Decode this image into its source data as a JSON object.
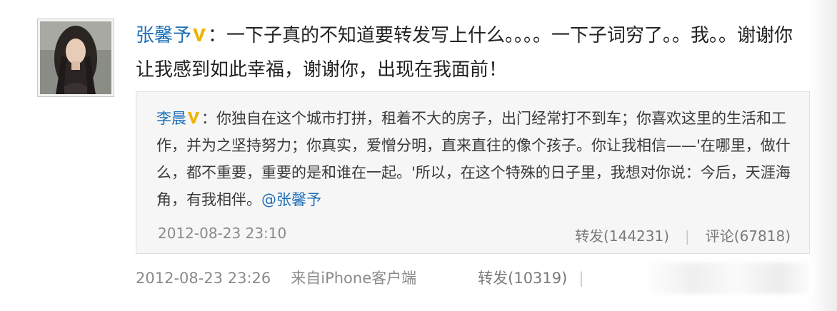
{
  "post": {
    "author": "张馨予",
    "colon": "：",
    "text": "一下子真的不知道要转发写上什么。。。。一下子词穷了。。我。。谢谢你让我感到如此幸福，谢谢你，出现在我面前！",
    "time": "2012-08-23 23:26",
    "source": "来自iPhone客户端",
    "forward": "转发(10319)",
    "separator": "|"
  },
  "retweet": {
    "author": "李晨",
    "colon": "：",
    "text": "你独自在这个城市打拼，租着不大的房子，出门经常打不到车；你喜欢这里的生活和工作，并为之坚持努力；你真实，爱憎分明，直来直往的像个孩子。你让我相信——'在哪里，做什么，都不重要，重要的是和谁在一起。'所以，在这个特殊的日子里，我想对你说：今后，天涯海角，有我相伴。",
    "mention": "@张馨予",
    "time": "2012-08-23 23:10",
    "forward": "转发(144231)",
    "separator": "|",
    "comment": "评论(67818)"
  },
  "colors": {
    "link": "#1d6fb8",
    "verified_badge": "#f0b400",
    "meta_text": "#8a8a8a",
    "retweet_bg": "#f6f6f6"
  },
  "icons": {
    "avatar": "user-avatar-photo",
    "verified": "verified-v-badge"
  }
}
